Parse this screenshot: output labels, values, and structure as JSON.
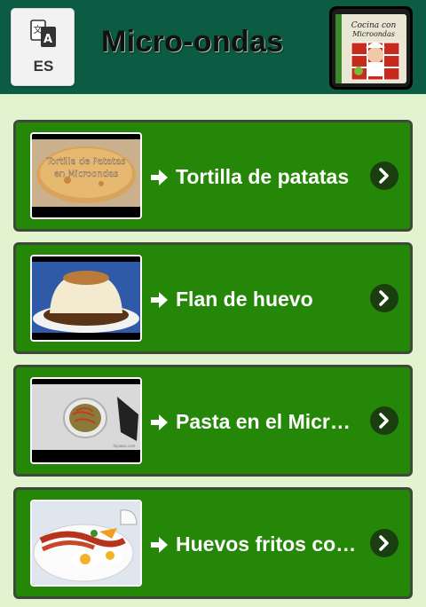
{
  "header": {
    "language_code": "ES",
    "title": "Micro-ondas",
    "book_line1": "Cocina con",
    "book_line2": "Microondas"
  },
  "recipes": [
    {
      "label": "Tortilla de patatas",
      "thumb_line1": "Tortilla de Patatas",
      "thumb_line2": "en Microondas"
    },
    {
      "label": "Flan de huevo"
    },
    {
      "label": "Pasta en el Microondas",
      "thumb_caption": "hipiwas.com"
    },
    {
      "label": "Huevos fritos con bacon"
    }
  ],
  "colors": {
    "header_bg": "#0c5c44",
    "page_bg": "#e2f4cf",
    "item_bg": "#258707",
    "item_border": "#3d4a37",
    "chevron_bg": "#1a3e10"
  },
  "icons": {
    "language": "translate-icon",
    "book": "cookbook-icon",
    "row_arrow": "arrow-right-icon",
    "row_chevron": "chevron-right-icon"
  }
}
